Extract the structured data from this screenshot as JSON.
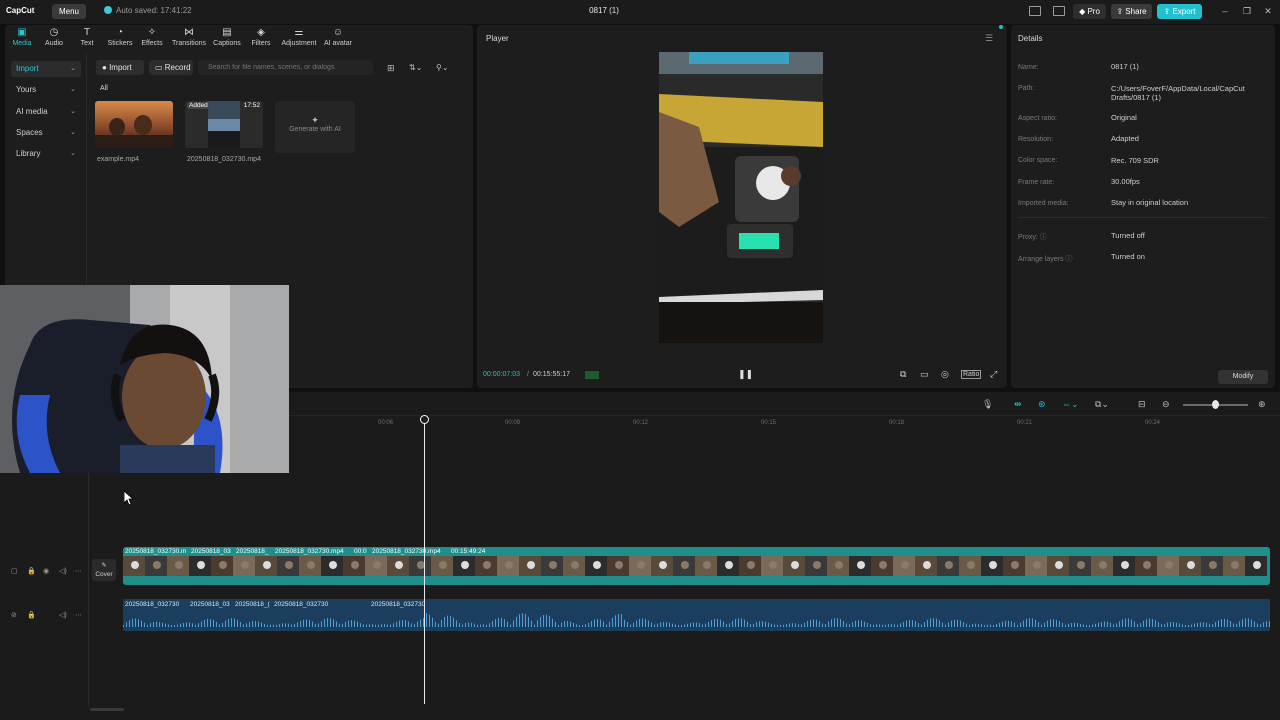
{
  "titlebar": {
    "logo": "CapCut",
    "menu_label": "Menu",
    "autosave": "Auto saved: 17:41:22",
    "doc_title": "0817 (1)",
    "pro_label": "Pro",
    "share_label": "Share",
    "export_label": "Export"
  },
  "media_tabs": [
    {
      "label": "Media",
      "icon": "media-icon",
      "active": true
    },
    {
      "label": "Audio",
      "icon": "audio-icon"
    },
    {
      "label": "Text",
      "icon": "text-icon"
    },
    {
      "label": "Stickers",
      "icon": "stickers-icon"
    },
    {
      "label": "Effects",
      "icon": "effects-icon"
    },
    {
      "label": "Transitions",
      "icon": "transitions-icon"
    },
    {
      "label": "Captions",
      "icon": "captions-icon"
    },
    {
      "label": "Filters",
      "icon": "filters-icon"
    },
    {
      "label": "Adjustment",
      "icon": "adjustment-icon"
    },
    {
      "label": "AI avatar",
      "icon": "ai-avatar-icon"
    }
  ],
  "sidebar": {
    "items": [
      {
        "label": "Import",
        "active": true
      },
      {
        "label": "Yours"
      },
      {
        "label": "AI media"
      },
      {
        "label": "Spaces"
      },
      {
        "label": "Library"
      }
    ]
  },
  "media": {
    "import_label": "Import",
    "record_label": "Record",
    "search_placeholder": "Search for file names, scenes, or dialogs",
    "filter_all": "All",
    "items": [
      {
        "name": "example.mp4"
      },
      {
        "name": "20250818_032730.mp4",
        "badge": "Added",
        "duration": "17:52"
      }
    ],
    "generate_ai": "Generate with AI"
  },
  "player": {
    "title": "Player",
    "current_time": "00:00:07:03",
    "total_time": "00:15:55:17"
  },
  "details": {
    "title": "Details",
    "rows": [
      {
        "label": "Name:",
        "value": "0817 (1)"
      },
      {
        "label": "Path:",
        "value": "C:/Users/FoverF/AppData/Local/CapCut Drafts/0817 (1)"
      },
      {
        "label": "Aspect ratio:",
        "value": "Original"
      },
      {
        "label": "Resolution:",
        "value": "Adapted"
      },
      {
        "label": "Color space:",
        "value": "Rec. 709 SDR"
      },
      {
        "label": "Frame rate:",
        "value": "30.00fps"
      },
      {
        "label": "Imported media:",
        "value": "Stay in original location"
      },
      {
        "label": "Proxy:",
        "value": "Turned off"
      },
      {
        "label": "Arrange layers",
        "value": "Turned on"
      }
    ],
    "modify_label": "Modify"
  },
  "timeline": {
    "ruler_ticks": [
      "00:06",
      "00:09",
      "00:12",
      "00:15",
      "00:18",
      "00:21",
      "00:24"
    ],
    "cover_label": "Cover",
    "video_clips": [
      {
        "label": "20250818_032730.m"
      },
      {
        "label": "20250818_03"
      },
      {
        "label": "20250818_"
      },
      {
        "label": "20250818_032730.mp4"
      },
      {
        "label": "00:0"
      },
      {
        "label": "20250818_032730.mp4"
      },
      {
        "label": "00:15:49:24"
      }
    ],
    "audio_clips": [
      {
        "label": "20250818_032730"
      },
      {
        "label": "20250818_03"
      },
      {
        "label": "20250818_("
      },
      {
        "label": "20250818_032730"
      },
      {
        "label": "20250818_032730"
      }
    ]
  },
  "colors": {
    "accent": "#21c0cc",
    "video_track": "#1e8f8a",
    "audio_track": "#1b3d5e"
  }
}
